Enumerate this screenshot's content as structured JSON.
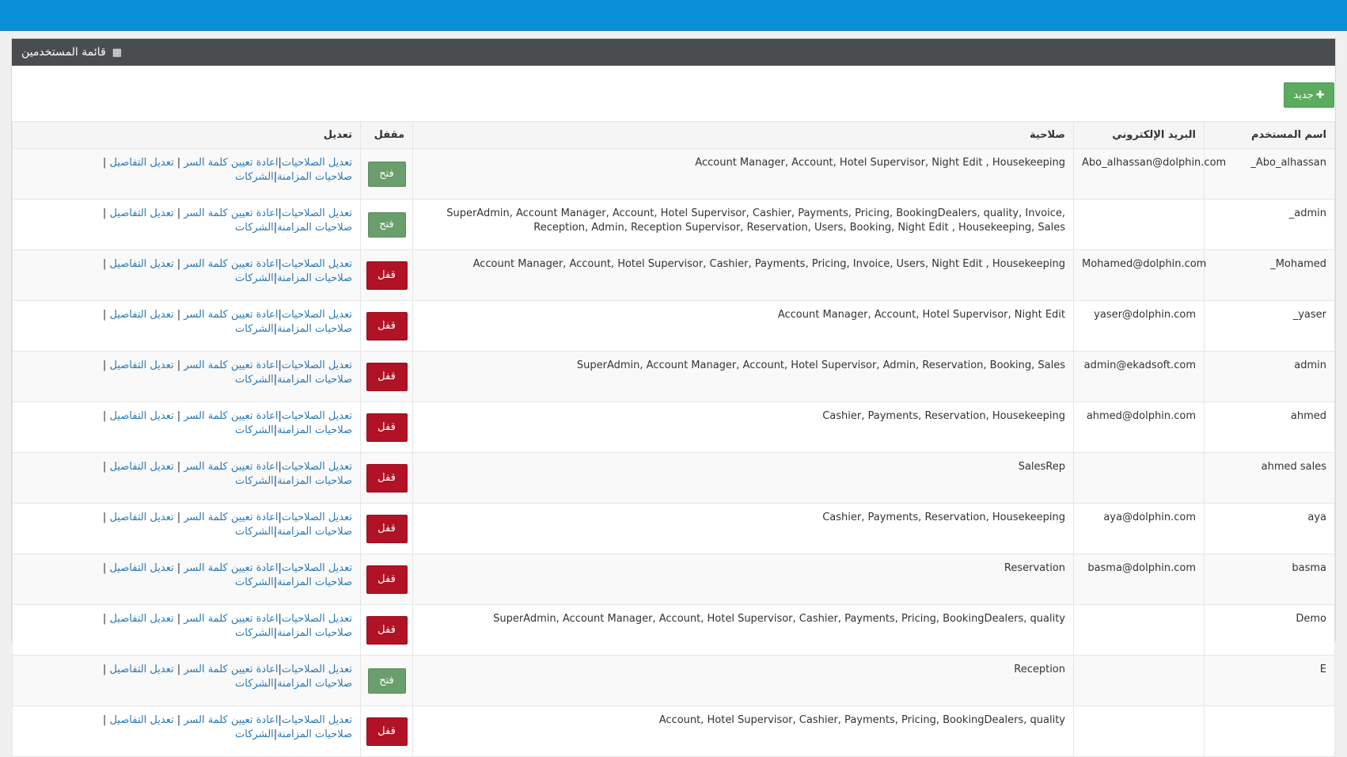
{
  "panel": {
    "title": "قائمة المستخدمين"
  },
  "toolbar": {
    "new_label": "جديد"
  },
  "table": {
    "headers": {
      "username": "اسم المستخدم",
      "email": "البريد الإلكتروني",
      "roles": "صلاحية",
      "locked": "مقفل",
      "edit": "تعديل"
    },
    "link_labels": {
      "edit_permissions": "تعديل الصلاحيات",
      "reset_password": "اعادة تعيين كلمة السر",
      "edit_details": "تعديل التفاصيل",
      "sync_permissions": "صلاحيات المزامنة",
      "companies": "الشركات"
    },
    "rows": [
      {
        "username": "Abo_alhassan_",
        "email": "Abo_alhassan@dolphin.com",
        "roles": "Account Manager, Account, Hotel Supervisor, Night Edit , Housekeeping",
        "lock_label": "فتح",
        "lock_state": "open"
      },
      {
        "username": "admin_",
        "email": "",
        "roles": "SuperAdmin, Account Manager, Account, Hotel Supervisor, Cashier, Payments, Pricing, BookingDealers, quality, Invoice, Reception, Admin, Reception Supervisor, Reservation, Users, Booking, Night Edit , Housekeeping, Sales",
        "lock_label": "فتح",
        "lock_state": "open"
      },
      {
        "username": "Mohamed_",
        "email": "Mohamed@dolphin.com",
        "roles": "Account Manager, Account, Hotel Supervisor, Cashier, Payments, Pricing, Invoice, Users, Night Edit , Housekeeping",
        "lock_label": "قفل",
        "lock_state": "locked"
      },
      {
        "username": "yaser_",
        "email": "yaser@dolphin.com",
        "roles": "Account Manager, Account, Hotel Supervisor, Night Edit",
        "lock_label": "قفل",
        "lock_state": "locked"
      },
      {
        "username": "admin",
        "email": "admin@ekadsoft.com",
        "roles": "SuperAdmin, Account Manager, Account, Hotel Supervisor, Admin, Reservation, Booking, Sales",
        "lock_label": "قفل",
        "lock_state": "locked"
      },
      {
        "username": "ahmed",
        "email": "ahmed@dolphin.com",
        "roles": "Cashier, Payments, Reservation, Housekeeping",
        "lock_label": "قفل",
        "lock_state": "locked"
      },
      {
        "username": "ahmed sales",
        "email": "",
        "roles": "SalesRep",
        "lock_label": "قفل",
        "lock_state": "locked"
      },
      {
        "username": "aya",
        "email": "aya@dolphin.com",
        "roles": "Cashier, Payments, Reservation, Housekeeping",
        "lock_label": "قفل",
        "lock_state": "locked"
      },
      {
        "username": "basma",
        "email": "basma@dolphin.com",
        "roles": "Reservation",
        "lock_label": "قفل",
        "lock_state": "locked"
      },
      {
        "username": "Demo",
        "email": "",
        "roles": "SuperAdmin, Account Manager, Account, Hotel Supervisor, Cashier, Payments, Pricing, BookingDealers, quality",
        "lock_label": "قفل",
        "lock_state": "locked"
      },
      {
        "username": "E",
        "email": "",
        "roles": "Reception",
        "lock_label": "فتح",
        "lock_state": "open"
      },
      {
        "username": "",
        "email": "",
        "roles": "Account, Hotel Supervisor, Cashier, Payments, Pricing, BookingDealers, quality",
        "lock_label": "قفل",
        "lock_state": "locked"
      }
    ]
  },
  "colors": {
    "topbar": "#0b8fd6",
    "panel_header": "#4a4d50",
    "new_button": "#5cab5f",
    "unlock_button": "#6a9e6c",
    "lock_button": "#b11226",
    "link": "#2a79b5"
  }
}
